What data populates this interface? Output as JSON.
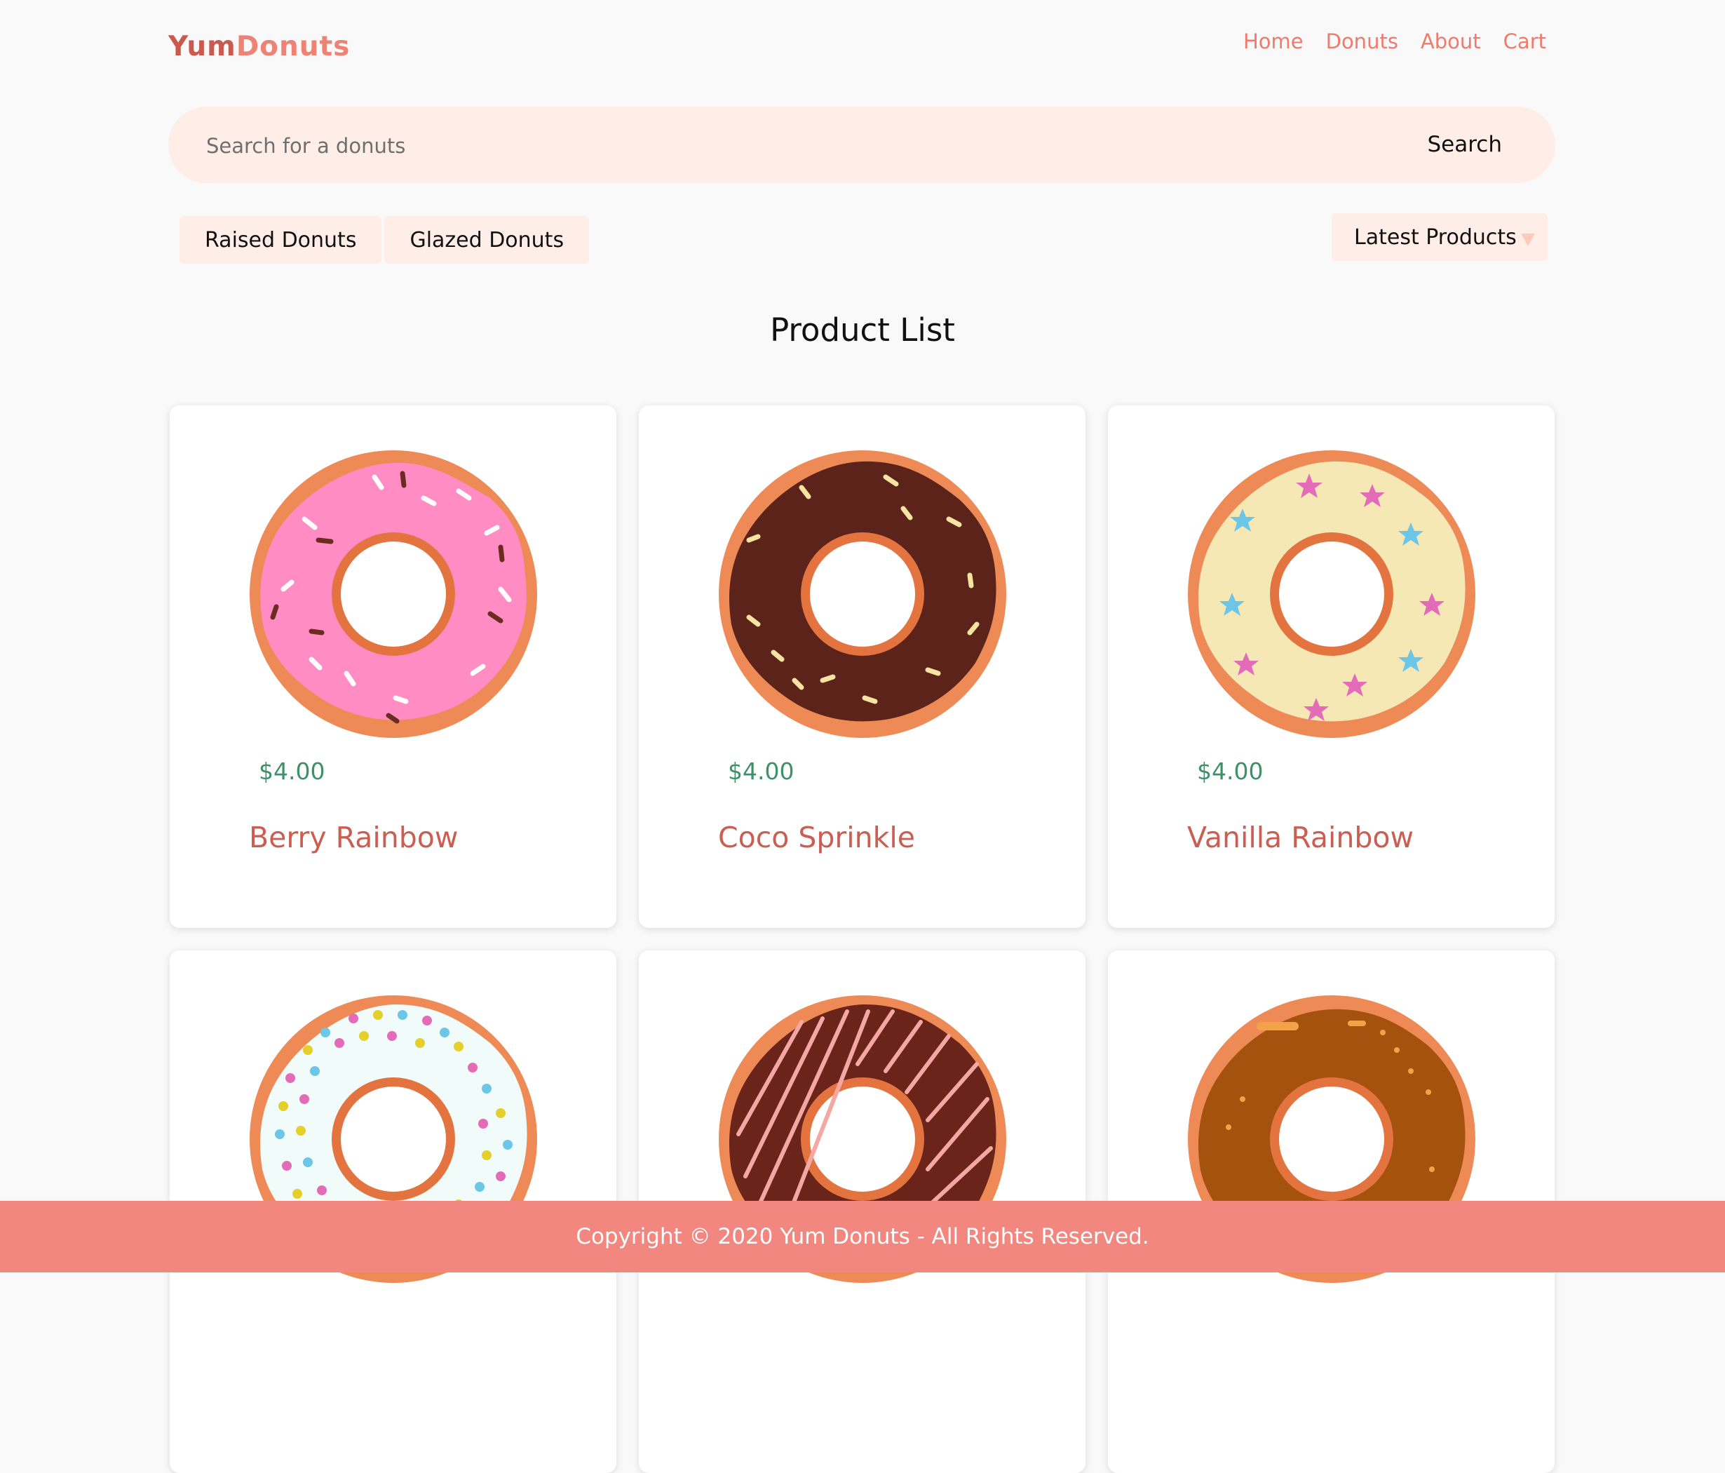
{
  "header": {
    "logo_part1": "Yum",
    "logo_part2": "Donuts",
    "nav": [
      "Home",
      "Donuts",
      "About",
      "Cart"
    ]
  },
  "search": {
    "placeholder": "Search for a donuts",
    "button_label": "Search"
  },
  "filters": [
    "Raised Donuts",
    "Glazed Donuts"
  ],
  "sort": {
    "selected": "Latest Products"
  },
  "main": {
    "title": "Product List"
  },
  "products": [
    {
      "name": "Berry Rainbow",
      "price": "$4.00",
      "icon": "pink-sprinkle-donut-icon"
    },
    {
      "name": "Coco Sprinkle",
      "price": "$4.00",
      "icon": "chocolate-sprinkle-donut-icon"
    },
    {
      "name": "Vanilla Rainbow",
      "price": "$4.00",
      "icon": "vanilla-star-donut-icon"
    },
    {
      "name": "",
      "price": "",
      "icon": "white-dot-sprinkle-donut-icon"
    },
    {
      "name": "",
      "price": "",
      "icon": "chocolate-drizzle-donut-icon"
    },
    {
      "name": "",
      "price": "",
      "icon": "caramel-donut-icon"
    }
  ],
  "footer": {
    "text": "Copyright © 2020 Yum Donuts - All Rights Reserved."
  },
  "colors": {
    "accent": "#ee8375",
    "footer": "#f2877f",
    "price": "#3e9068",
    "product_name": "#cb5e52",
    "pill": "#ffeee7"
  }
}
